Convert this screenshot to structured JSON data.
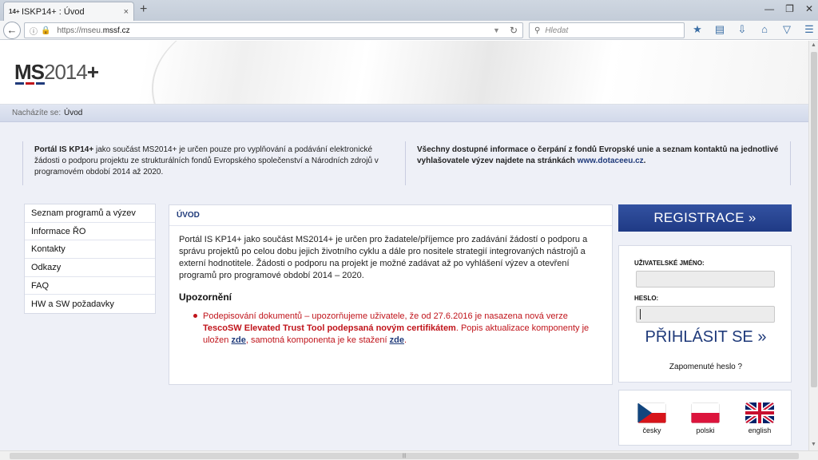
{
  "browser": {
    "tab_favicon": "14+",
    "tab_title": "ISKP14+ : Úvod",
    "tab_close": "×",
    "new_tab": "+",
    "url_prefix": "https://mseu.",
    "url_domain": "mssf.cz",
    "search_placeholder": "Hledat"
  },
  "header": {
    "logo_ms": "MS",
    "logo_year": "2014",
    "logo_plus": "+",
    "logo_colors": [
      "#1f3a7a",
      "#c0141b",
      "#1f3a7a"
    ]
  },
  "breadcrumb": {
    "label": "Nacházíte se:",
    "current": "Úvod"
  },
  "info": {
    "left_bold": "Portál IS KP14+",
    "left_rest": " jako součást MS2014+ je určen pouze pro vyplňování a podávání elektronické žádosti o podporu projektu ze strukturálních fondů Evropského společenství a Národních zdrojů v programovém období 2014 až 2020.",
    "right_bold": "Všechny dostupné informace o čerpání z fondů Evropské unie a seznam kontaktů na jednotlivé vyhlašovatele výzev najdete na stránkách ",
    "right_link": "www.dotaceeu.cz",
    "right_end": "."
  },
  "menu": {
    "items": [
      {
        "label": "Seznam programů a výzev"
      },
      {
        "label": "Informace ŘO"
      },
      {
        "label": "Kontakty"
      },
      {
        "label": "Odkazy"
      },
      {
        "label": "FAQ"
      },
      {
        "label": "HW a SW požadavky"
      }
    ]
  },
  "main": {
    "title": "ÚVOD",
    "text": "Portál IS KP14+ jako součást MS2014+ je určen pro žadatele/příjemce pro zadávání žádostí o podporu a správu projektů po celou dobu jejich životního cyklu a dále pro nositele strategií integrovaných nástrojů a externí hodnotitele. Žádosti o podporu na projekt je možné zadávat až po vyhlášení výzev a otevření programů pro programové období 2014 – 2020.",
    "warning_heading": "Upozornění",
    "warning_part1": "Podepisování dokumentů – upozorňujeme uživatele, že od 27.6.2016 je nasazena nová verze ",
    "warning_bold": "TescoSW Elevated Trust Tool podepsaná novým certifikátem",
    "warning_part2": ". Popis aktualizace komponenty je uložen ",
    "warning_link1": "zde",
    "warning_part3": ", samotná komponenta je ke stažení ",
    "warning_link2": "zde",
    "warning_end": "."
  },
  "register": {
    "label": "REGISTRACE »",
    "color": "#2a4694"
  },
  "login": {
    "username_label": "UŽIVATELSKÉ JMÉNO:",
    "username_value": "",
    "password_label": "HESLO:",
    "password_value": "",
    "submit_label": "PŘIHLÁSIT SE »",
    "forgot_label": "Zapomenuté heslo ?"
  },
  "languages": [
    {
      "name": "česky",
      "icon": "czech-flag-icon"
    },
    {
      "name": "polski",
      "icon": "polish-flag-icon"
    },
    {
      "name": "english",
      "icon": "uk-flag-icon"
    }
  ]
}
